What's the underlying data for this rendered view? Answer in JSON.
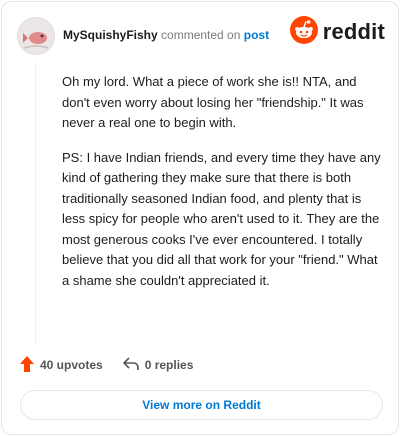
{
  "comment": {
    "author": "MySquishyFishy",
    "action_text": "commented on",
    "post_link_label": "post",
    "paragraphs": [
      "Oh my lord. What a piece of work she is!! NTA, and don't even worry about losing her \"friendship.\" It was never a real one to begin with.",
      "PS: I have Indian friends, and every time they have any kind of gathering they make sure that there is both traditionally seasoned Indian food, and plenty that is less spicy for people who aren't used to it. They are the most generous cooks I've ever encountered. I totally believe that you did all that work for your \"friend.\" What a shame she couldn't appreciated it."
    ],
    "upvotes_label": "40 upvotes",
    "replies_label": "0 replies"
  },
  "brand": {
    "wordmark": "reddit",
    "accent_color": "#ff4500",
    "link_color": "#0079d3"
  },
  "footer": {
    "view_more_label": "View more on Reddit"
  },
  "icons": {
    "logo": "reddit-alien-icon",
    "upvote": "upvote-arrow-icon",
    "reply": "reply-arrow-icon"
  }
}
